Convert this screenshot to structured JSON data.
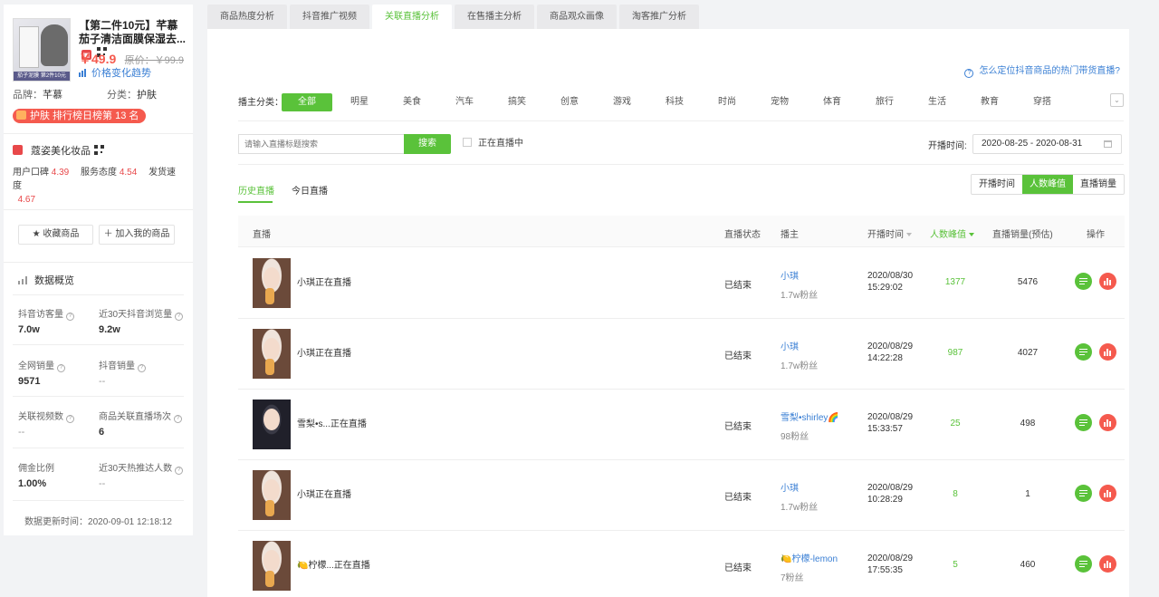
{
  "product": {
    "title": "【第二件10元】芊慕茄子清洁面膜保湿去...",
    "thumb_banner": "茄子泥膜 第2件10元",
    "price": "￥49.9",
    "orig_price": "原价：￥99.9",
    "trend_link": "价格变化趋势",
    "brand_label": "品牌：",
    "brand_value": "芊慕",
    "category_label": "分类：",
    "category_value": "护肤",
    "rank_badge": "护肤 排行榜日榜第 13 名"
  },
  "shop": {
    "name": "蔻姿美化妆品",
    "reputation_label": "用户口碑",
    "reputation_value": "4.39",
    "service_label": "服务态度",
    "service_value": "4.54",
    "delivery_label": "发货速度",
    "delivery_value": "4.67"
  },
  "actions": {
    "favorite": "★ 收藏商品",
    "add_mine": "＋ 加入我的商品"
  },
  "overview": {
    "title": "数据概览",
    "stats": [
      {
        "label": "抖音访客量",
        "value": "7.0w"
      },
      {
        "label": "近30天抖音浏览量",
        "value": "9.2w"
      },
      {
        "label": "全网销量",
        "value": "9571"
      },
      {
        "label": "抖音销量",
        "value": "--"
      },
      {
        "label": "关联视频数",
        "value": "--"
      },
      {
        "label": "商品关联直播场次",
        "value": "6"
      },
      {
        "label": "佣金比例",
        "value": "1.00%"
      },
      {
        "label": "近30天热推达人数",
        "value": "--"
      }
    ],
    "update_time": "数据更新时间：2020-09-01 12:18:12"
  },
  "tabs": [
    "商品热度分析",
    "抖音推广视频",
    "关联直播分析",
    "在售播主分析",
    "商品观众画像",
    "淘客推广分析"
  ],
  "help_link": "怎么定位抖音商品的热门带货直播?",
  "filter": {
    "category_label": "播主分类：",
    "categories": [
      "全部",
      "明星",
      "美食",
      "汽车",
      "搞笑",
      "创意",
      "游戏",
      "科技",
      "时尚",
      "宠物",
      "体育",
      "旅行",
      "生活",
      "教育",
      "穿搭"
    ],
    "search_placeholder": "请输入直播标题搜索",
    "search_button": "搜索",
    "live_checkbox": "正在直播中",
    "date_label": "开播时间:",
    "date_range": "2020-08-25 - 2020-08-31"
  },
  "subtabs": [
    "历史直播",
    "今日直播"
  ],
  "sort_buttons": [
    "开播时间",
    "人数峰值",
    "直播销量"
  ],
  "table": {
    "headers": [
      "直播",
      "直播状态",
      "播主",
      "开播时间",
      "人数峰值",
      "直播销量(预估)",
      "操作"
    ],
    "rows": [
      {
        "title": "小琪正在直播",
        "status": "已结束",
        "anchor": "小琪",
        "fans": "1.7w粉丝",
        "date": "2020/08/30",
        "time": "15:29:02",
        "peak": "1377",
        "sales": "5476"
      },
      {
        "title": "小琪正在直播",
        "status": "已结束",
        "anchor": "小琪",
        "fans": "1.7w粉丝",
        "date": "2020/08/29",
        "time": "14:22:28",
        "peak": "987",
        "sales": "4027"
      },
      {
        "title": "雪梨•s...正在直播",
        "status": "已结束",
        "anchor": "雪梨•shirley🌈",
        "fans": "98粉丝",
        "date": "2020/08/29",
        "time": "15:33:57",
        "peak": "25",
        "sales": "498"
      },
      {
        "title": "小琪正在直播",
        "status": "已结束",
        "anchor": "小琪",
        "fans": "1.7w粉丝",
        "date": "2020/08/29",
        "time": "10:28:29",
        "peak": "8",
        "sales": "1"
      },
      {
        "title": "🍋柠檬...正在直播",
        "status": "已结束",
        "anchor": "🍋柠檬-lemon",
        "fans": "7粉丝",
        "date": "2020/08/29",
        "time": "17:55:35",
        "peak": "5",
        "sales": "460"
      }
    ]
  },
  "colors": {
    "accent": "#5ac23a",
    "price": "#f55a4e",
    "link": "#3a7fd4"
  }
}
